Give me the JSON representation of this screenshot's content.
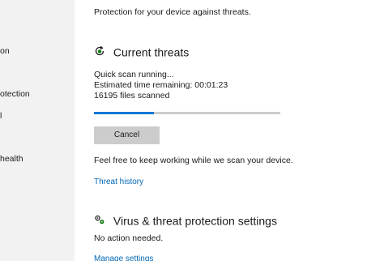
{
  "sidebar": {
    "items": [
      {
        "label": "on",
        "icon": "virus-protection-icon"
      },
      {
        "label": "otection",
        "icon": "firewall-icon"
      },
      {
        "label": "l",
        "icon": "app-browser-icon"
      },
      {
        "label": " health",
        "icon": "device-health-icon"
      }
    ]
  },
  "intro_text": "Protection for your device against threats.",
  "current_threats": {
    "title": "Current threats",
    "icon": "refresh-shield-icon",
    "status": "Quick scan running...",
    "time_remaining": "Estimated time remaining: 00:01:23",
    "files_scanned": "16195  files scanned",
    "progress": 0.32,
    "cancel_label": "Cancel",
    "note": "Feel free to keep working while we scan your device.",
    "history_link": "Threat history"
  },
  "settings": {
    "title": "Virus & threat protection settings",
    "icon": "settings-gears-icon",
    "status": "No action needed.",
    "manage_link": "Manage settings"
  },
  "colors": {
    "accent": "#0078d7",
    "link": "#0066b4",
    "sidebar_bg": "#f2f2f2",
    "button_bg": "#cccccc",
    "icon_green": "#107c10"
  }
}
